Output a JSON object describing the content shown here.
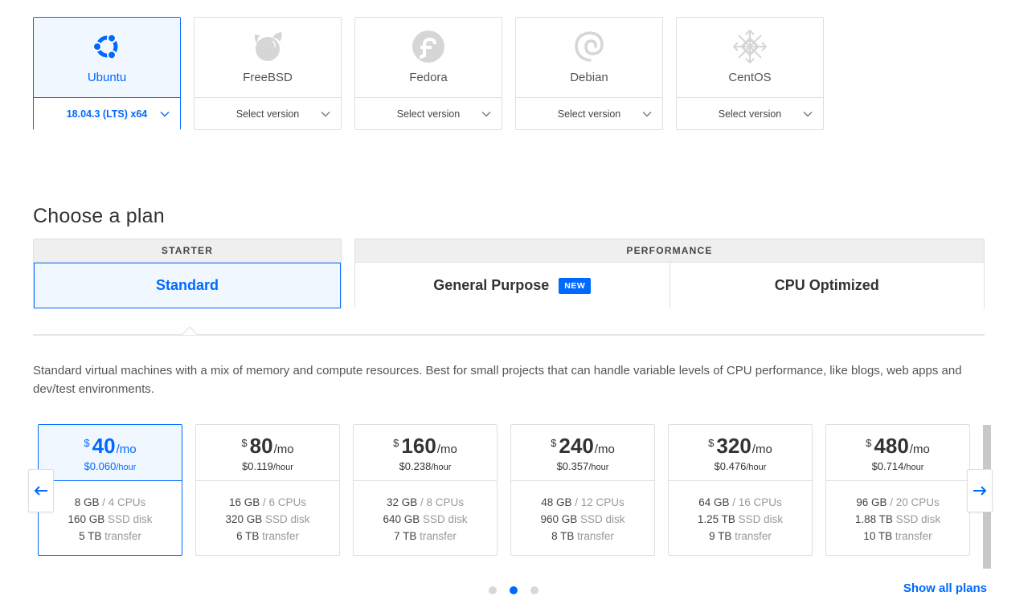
{
  "distros": [
    {
      "name": "Ubuntu",
      "version": "18.04.3 (LTS) x64",
      "icon": "ubuntu-icon",
      "active": true
    },
    {
      "name": "FreeBSD",
      "version": "Select version",
      "icon": "freebsd-icon",
      "active": false
    },
    {
      "name": "Fedora",
      "version": "Select version",
      "icon": "fedora-icon",
      "active": false
    },
    {
      "name": "Debian",
      "version": "Select version",
      "icon": "debian-icon",
      "active": false
    },
    {
      "name": "CentOS",
      "version": "Select version",
      "icon": "centos-icon",
      "active": false
    }
  ],
  "plan_section": {
    "title": "Choose a plan",
    "starter": {
      "header": "STARTER",
      "tabs": [
        "Standard"
      ]
    },
    "performance": {
      "header": "PERFORMANCE",
      "tabs": [
        "General Purpose",
        "CPU Optimized"
      ],
      "badge": "NEW"
    },
    "description": "Standard virtual machines with a mix of memory and compute resources. Best for small projects that can handle variable levels of CPU performance, like blogs, web apps and dev/test environments."
  },
  "plans": [
    {
      "currency": "$",
      "monthly": "40",
      "per_month": "/mo",
      "hourly": "$0.060",
      "per_hour": "/hour",
      "memory": "8 GB",
      "cpus": "/ 4 CPUs",
      "disk": "160 GB",
      "disk_label": "SSD disk",
      "transfer": "5 TB",
      "transfer_label": "transfer"
    },
    {
      "currency": "$",
      "monthly": "80",
      "per_month": "/mo",
      "hourly": "$0.119",
      "per_hour": "/hour",
      "memory": "16 GB",
      "cpus": "/ 6 CPUs",
      "disk": "320 GB",
      "disk_label": "SSD disk",
      "transfer": "6 TB",
      "transfer_label": "transfer"
    },
    {
      "currency": "$",
      "monthly": "160",
      "per_month": "/mo",
      "hourly": "$0.238",
      "per_hour": "/hour",
      "memory": "32 GB",
      "cpus": "/ 8 CPUs",
      "disk": "640 GB",
      "disk_label": "SSD disk",
      "transfer": "7 TB",
      "transfer_label": "transfer"
    },
    {
      "currency": "$",
      "monthly": "240",
      "per_month": "/mo",
      "hourly": "$0.357",
      "per_hour": "/hour",
      "memory": "48 GB",
      "cpus": "/ 12 CPUs",
      "disk": "960 GB",
      "disk_label": "SSD disk",
      "transfer": "8 TB",
      "transfer_label": "transfer"
    },
    {
      "currency": "$",
      "monthly": "320",
      "per_month": "/mo",
      "hourly": "$0.476",
      "per_hour": "/hour",
      "memory": "64 GB",
      "cpus": "/ 16 CPUs",
      "disk": "1.25 TB",
      "disk_label": "SSD disk",
      "transfer": "9 TB",
      "transfer_label": "transfer"
    },
    {
      "currency": "$",
      "monthly": "480",
      "per_month": "/mo",
      "hourly": "$0.714",
      "per_hour": "/hour",
      "memory": "96 GB",
      "cpus": "/ 20 CPUs",
      "disk": "1.88 TB",
      "disk_label": "SSD disk",
      "transfer": "10 TB",
      "transfer_label": "transfer"
    }
  ],
  "carousel": {
    "prev_icon": "arrow-left-icon",
    "next_icon": "arrow-right-icon",
    "page_count": 3,
    "current_page": 2
  },
  "show_all_label": "Show all plans",
  "colors": {
    "accent": "#0069ff",
    "active_bg": "#f1f7ff",
    "border": "#dfdfdf"
  }
}
